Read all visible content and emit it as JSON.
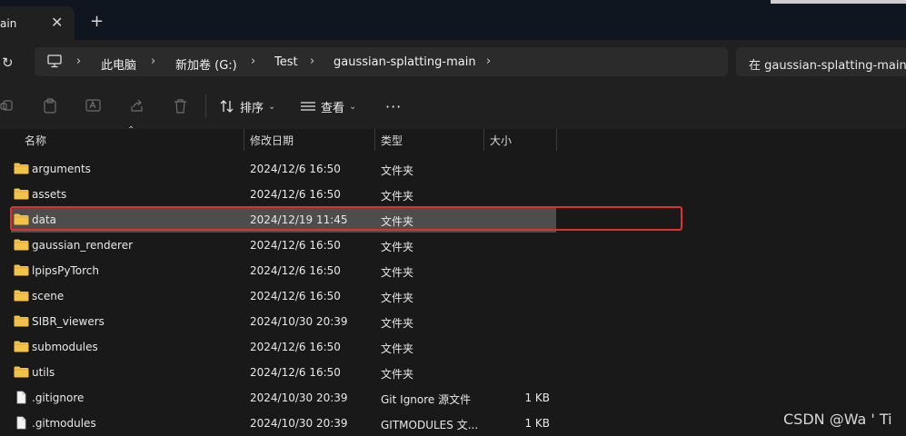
{
  "window": {
    "tab_title": "ain",
    "tab_close": "✕",
    "new_tab": "+"
  },
  "address": {
    "refresh": "↻",
    "crumbs": [
      "此电脑",
      "新加卷 (G:)",
      "Test",
      "gaussian-splatting-main"
    ],
    "separator": "›",
    "search_placeholder": "在 gaussian-splatting-main 中"
  },
  "toolbar": {
    "sort_label": "排序",
    "view_label": "查看",
    "more_label": "···",
    "caret": "⌄"
  },
  "columns": {
    "name": "名称",
    "date": "修改日期",
    "type": "类型",
    "size": "大小",
    "sort_caret": "⌃"
  },
  "rows": [
    {
      "name": "arguments",
      "date": "2024/12/6 16:50",
      "type": "文件夹",
      "size": "",
      "icon": "folder"
    },
    {
      "name": "assets",
      "date": "2024/12/6 16:50",
      "type": "文件夹",
      "size": "",
      "icon": "folder"
    },
    {
      "name": "data",
      "date": "2024/12/19 11:45",
      "type": "文件夹",
      "size": "",
      "icon": "folder"
    },
    {
      "name": "gaussian_renderer",
      "date": "2024/12/6 16:50",
      "type": "文件夹",
      "size": "",
      "icon": "folder"
    },
    {
      "name": "lpipsPyTorch",
      "date": "2024/12/6 16:50",
      "type": "文件夹",
      "size": "",
      "icon": "folder"
    },
    {
      "name": "scene",
      "date": "2024/12/6 16:50",
      "type": "文件夹",
      "size": "",
      "icon": "folder"
    },
    {
      "name": "SIBR_viewers",
      "date": "2024/10/30 20:39",
      "type": "文件夹",
      "size": "",
      "icon": "folder"
    },
    {
      "name": "submodules",
      "date": "2024/12/6 16:50",
      "type": "文件夹",
      "size": "",
      "icon": "folder"
    },
    {
      "name": "utils",
      "date": "2024/12/6 16:50",
      "type": "文件夹",
      "size": "",
      "icon": "folder"
    },
    {
      "name": ".gitignore",
      "date": "2024/10/30 20:39",
      "type": "Git Ignore 源文件",
      "size": "1 KB",
      "icon": "file"
    },
    {
      "name": ".gitmodules",
      "date": "2024/10/30 20:39",
      "type": "GITMODULES 文...",
      "size": "1 KB",
      "icon": "file"
    }
  ],
  "watermark": "CSDN @Wa ' Ti",
  "colors": {
    "selection": "#4d4d4d",
    "highlight_border": "#e0302a",
    "folder": "#f3c24a"
  }
}
